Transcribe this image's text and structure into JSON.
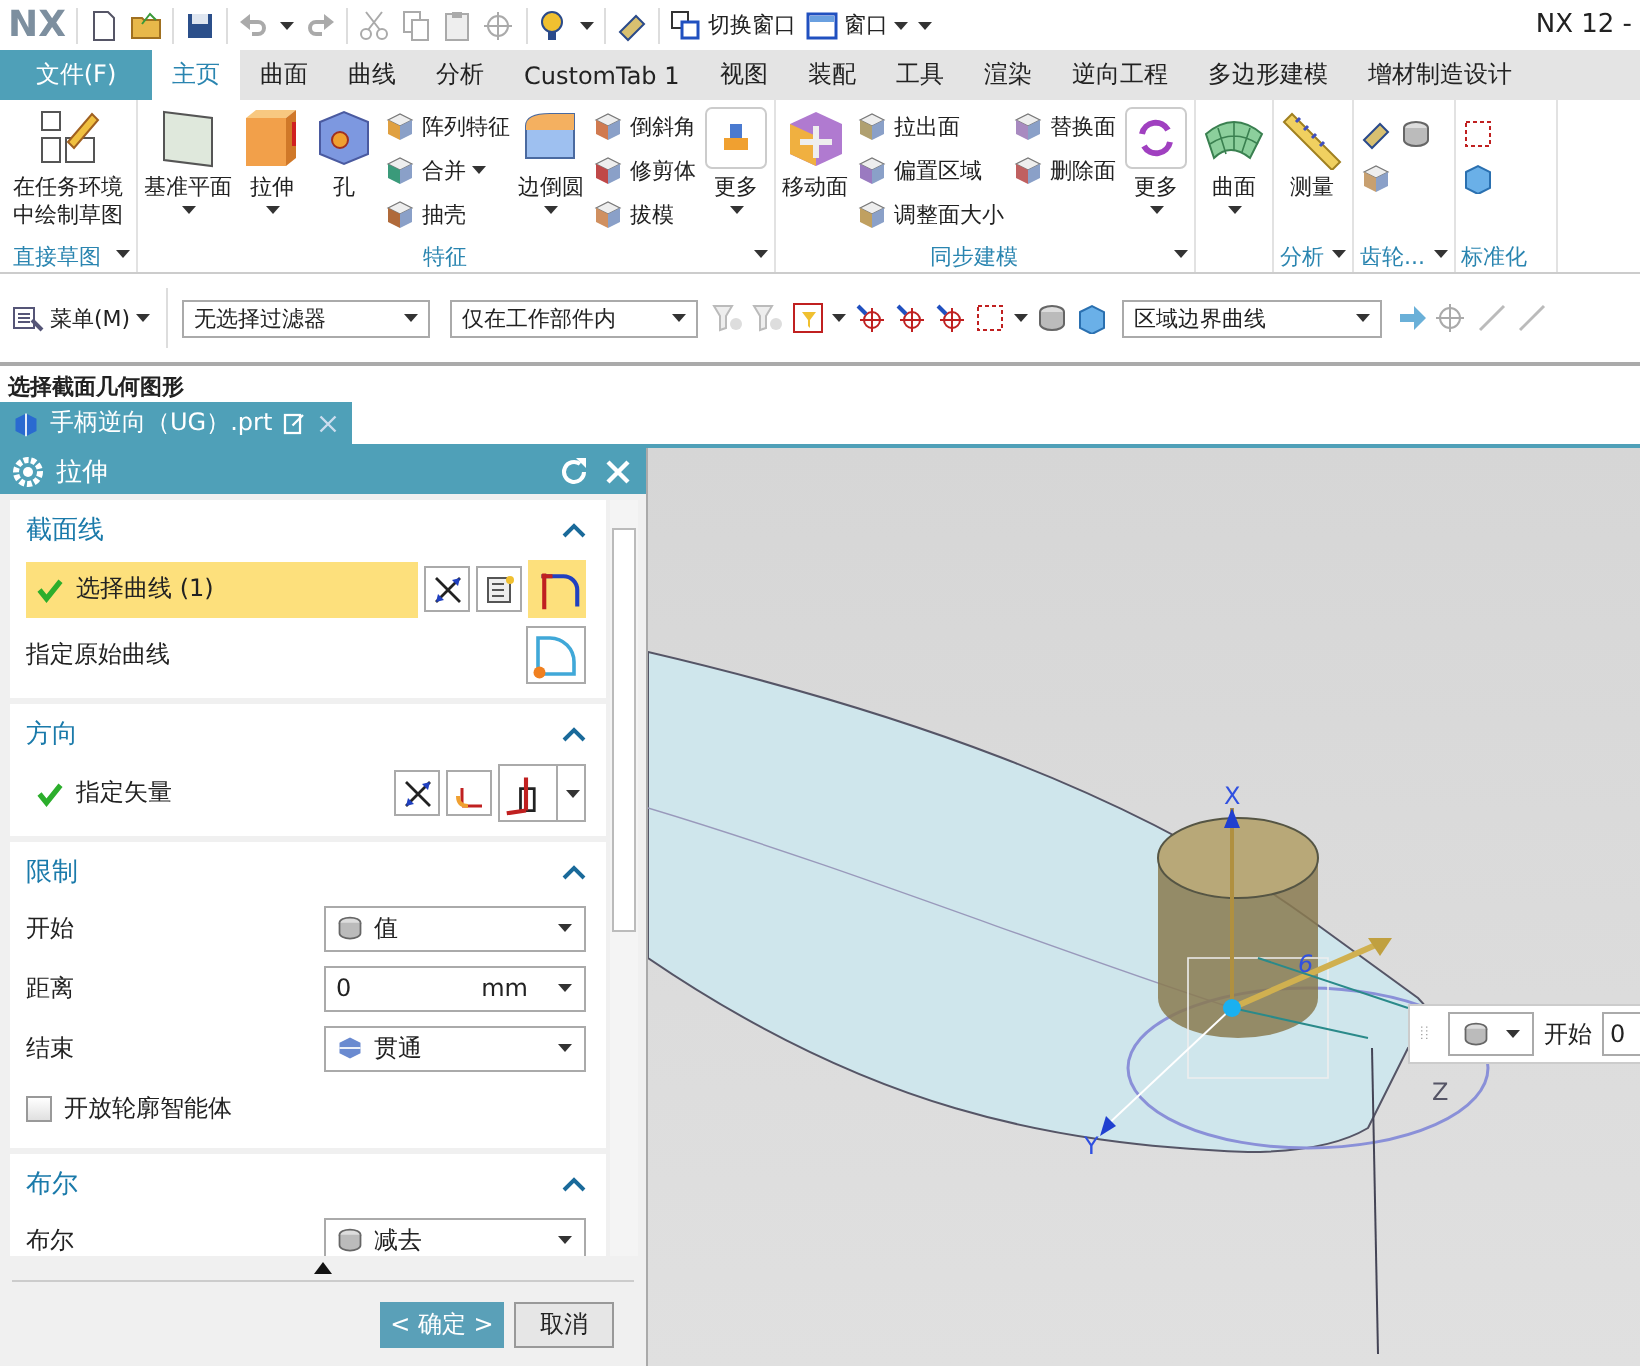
{
  "title_bar": {
    "logo": "NX",
    "window_buttons": [
      {
        "label": "切换窗口",
        "dropdown": false
      },
      {
        "label": "窗口",
        "dropdown": true
      }
    ],
    "title": "NX 12 -"
  },
  "file_tab": "文件(F)",
  "ribbon_tabs": [
    {
      "label": "主页",
      "selected": true
    },
    {
      "label": "曲面",
      "selected": false
    },
    {
      "label": "曲线",
      "selected": false
    },
    {
      "label": "分析",
      "selected": false
    },
    {
      "label": "CustomTab 1",
      "selected": false
    },
    {
      "label": "视图",
      "selected": false
    },
    {
      "label": "装配",
      "selected": false
    },
    {
      "label": "工具",
      "selected": false
    },
    {
      "label": "渲染",
      "selected": false
    },
    {
      "label": "逆向工程",
      "selected": false
    },
    {
      "label": "多边形建模",
      "selected": false
    },
    {
      "label": "增材制造设计",
      "selected": false
    }
  ],
  "ribbon_groups": [
    {
      "label": "直接草图",
      "menu": true,
      "items": [
        {
          "kind": "large",
          "label": "在任务环境中绘制草图",
          "dropdown": false
        }
      ]
    },
    {
      "label": "特征",
      "menu": true,
      "items": [
        {
          "kind": "large",
          "label": "基准平面",
          "dropdown": true
        },
        {
          "kind": "large",
          "label": "拉伸",
          "dropdown": true
        },
        {
          "kind": "large",
          "label": "孔",
          "dropdown": false
        },
        {
          "kind": "stack",
          "buttons": [
            {
              "label": "阵列特征",
              "dropdown": false
            },
            {
              "label": "合并",
              "dropdown": true
            },
            {
              "label": "抽壳",
              "dropdown": false
            }
          ]
        },
        {
          "kind": "large",
          "label": "边倒圆",
          "dropdown": true
        },
        {
          "kind": "stack",
          "buttons": [
            {
              "label": "倒斜角",
              "dropdown": false
            },
            {
              "label": "修剪体",
              "dropdown": false
            },
            {
              "label": "拔模",
              "dropdown": false
            }
          ]
        },
        {
          "kind": "boxed",
          "label": "更多",
          "dropdown": true
        }
      ]
    },
    {
      "label": "同步建模",
      "menu": true,
      "items": [
        {
          "kind": "large",
          "label": "移动面",
          "dropdown": false
        },
        {
          "kind": "stack",
          "buttons": [
            {
              "label": "拉出面",
              "dropdown": false
            },
            {
              "label": "偏置区域",
              "dropdown": false
            },
            {
              "label": "调整面大小",
              "dropdown": false
            }
          ]
        },
        {
          "kind": "stack",
          "buttons": [
            {
              "label": "替换面",
              "dropdown": false
            },
            {
              "label": "删除面",
              "dropdown": false
            }
          ]
        },
        {
          "kind": "boxed",
          "label": "更多",
          "dropdown": true
        }
      ]
    },
    {
      "items": [
        {
          "kind": "large",
          "label": "曲面",
          "dropdown": true
        }
      ]
    },
    {
      "label": "分析",
      "menu": true,
      "items": [
        {
          "kind": "large",
          "label": "测量",
          "dropdown": false
        }
      ]
    },
    {
      "label": "齿轮...",
      "menu": true,
      "items": [
        {
          "kind": "icons"
        }
      ]
    },
    {
      "label": "标准化",
      "menu": false,
      "items": [
        {
          "kind": "icons"
        }
      ]
    }
  ],
  "toolbar": {
    "menu_button": "菜单(M)",
    "filters": [
      {
        "value": "无选择过滤器"
      },
      {
        "value": "仅在工作部件内"
      }
    ],
    "curve_rule": "区域边界曲线"
  },
  "cue_line": "选择截面几何图形",
  "doc_tab": {
    "label": "手柄逆向（UG）.prt"
  },
  "dialog": {
    "title": "拉伸",
    "sections": [
      {
        "title": "截面线",
        "expanded": true,
        "rows": [
          {
            "kind": "selection",
            "label": "选择曲线 (1)",
            "complete": true,
            "selected": true
          },
          {
            "kind": "action",
            "label": "指定原始曲线"
          }
        ]
      },
      {
        "title": "方向",
        "expanded": true,
        "rows": [
          {
            "kind": "vector",
            "label": "指定矢量",
            "complete": true,
            "selected": false
          }
        ]
      },
      {
        "title": "限制",
        "expanded": true,
        "rows": [
          {
            "kind": "select",
            "label": "开始",
            "value": "值"
          },
          {
            "kind": "number",
            "label": "距离",
            "value": "0",
            "unit": "mm"
          },
          {
            "kind": "select",
            "label": "结束",
            "value": "贯通"
          },
          {
            "kind": "checkbox",
            "label": "开放轮廓智能体",
            "checked": false
          }
        ]
      },
      {
        "title": "布尔",
        "expanded": true,
        "rows": [
          {
            "kind": "select",
            "label": "布尔",
            "value": "减去"
          }
        ]
      }
    ],
    "buttons": [
      {
        "label": "< 确定 >",
        "default": true
      },
      {
        "label": "取消",
        "default": false
      }
    ]
  },
  "viewport": {
    "axis_labels": [
      "X",
      "Y",
      "Z"
    ],
    "dimension": "6",
    "float_bar": {
      "label": "开始",
      "value": "0"
    }
  }
}
